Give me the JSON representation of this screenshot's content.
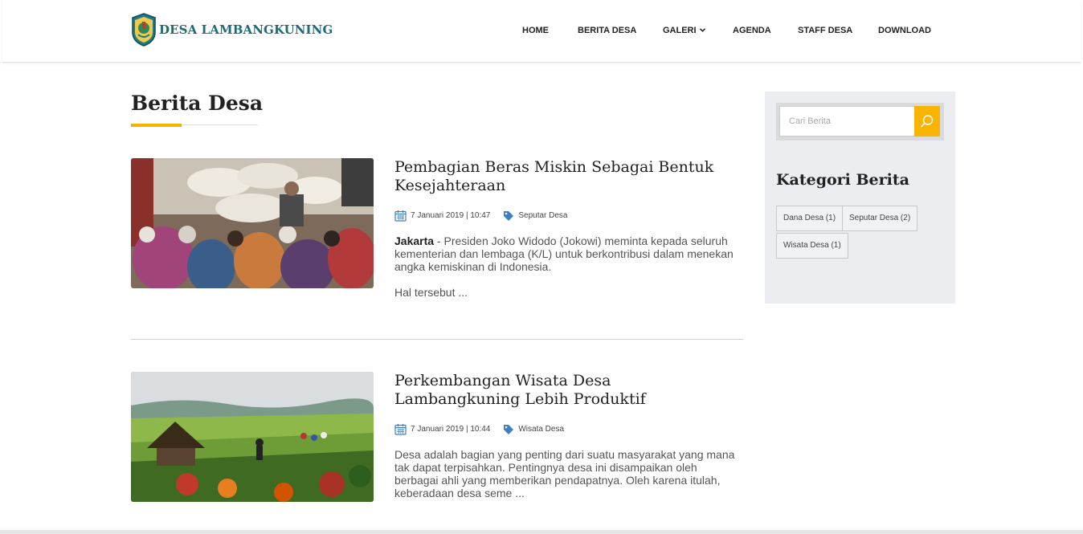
{
  "brand": {
    "name": "DESA LAMBANGKUNING",
    "logo_icon": "regency-emblem-icon"
  },
  "nav": {
    "items": [
      {
        "label": "HOME"
      },
      {
        "label": "BERITA DESA"
      },
      {
        "label": "GALERI",
        "has_dropdown": true
      },
      {
        "label": "AGENDA"
      },
      {
        "label": "STAFF DESA"
      },
      {
        "label": "DOWNLOAD"
      }
    ]
  },
  "page": {
    "title": "Berita Desa"
  },
  "posts": [
    {
      "title": "Pembagian Beras Miskin Sebagai Bentuk Kesejahteraan",
      "date": "7 Januari 2019 | 10:47",
      "category": "Seputar Desa",
      "lead": "Jakarta",
      "excerpt": " - Presiden Joko Widodo (Jokowi) meminta kepada seluruh kementerian dan lembaga (K/L) untuk berkontribusi dalam menekan angka kemiskinan di Indonesia.",
      "more": "Hal tersebut ..."
    },
    {
      "title": "Perkembangan Wisata Desa Lambangkuning Lebih Produktif",
      "date": "7 Januari 2019 | 10:44",
      "category": "Wisata Desa",
      "excerpt": "Desa adalah bagian yang penting dari suatu masyarakat yang mana tak dapat terpisahkan. Pentingnya desa ini disampaikan oleh berbagai ahli yang memberikan pendapatnya. Oleh karena itulah, keberadaan desa seme ..."
    }
  ],
  "sidebar": {
    "search_placeholder": "Cari Berita",
    "heading": "Kategori Berita",
    "categories": [
      {
        "label": "Dana Desa (1)"
      },
      {
        "label": "Seputar Desa (2)"
      },
      {
        "label": "Wisata Desa (1)"
      }
    ]
  },
  "colors": {
    "accent": "#f8b400",
    "brand_teal": "#1d6b78",
    "tag_blue": "#3b7fc4",
    "sidebar_bg": "#ebedf0"
  }
}
